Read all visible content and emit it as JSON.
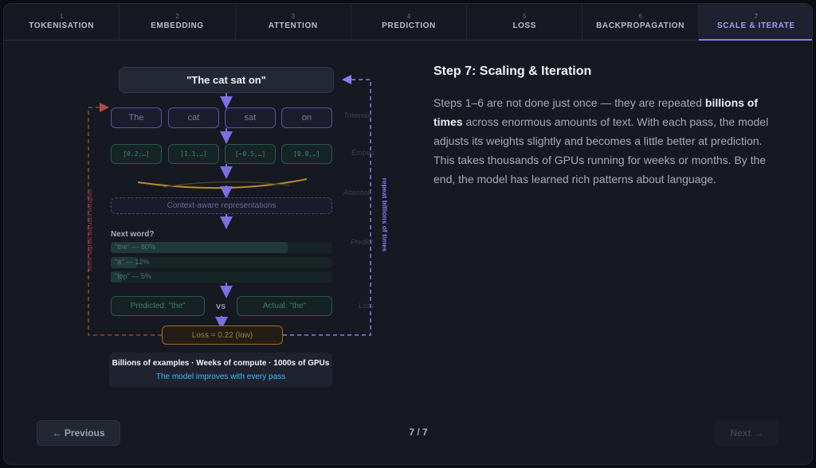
{
  "tabs": [
    {
      "num": "1",
      "label": "TOKENISATION",
      "active": false
    },
    {
      "num": "2",
      "label": "EMBEDDING",
      "active": false
    },
    {
      "num": "3",
      "label": "ATTENTION",
      "active": false
    },
    {
      "num": "4",
      "label": "PREDICTION",
      "active": false
    },
    {
      "num": "5",
      "label": "LOSS",
      "active": false
    },
    {
      "num": "6",
      "label": "BACKPROPAGATION",
      "active": false
    },
    {
      "num": "7",
      "label": "SCALE & ITERATE",
      "active": true
    }
  ],
  "diagram": {
    "input": "\"The cat sat on\"",
    "tokens": [
      "The",
      "cat",
      "sat",
      "on"
    ],
    "embeddings": [
      "[0.2,…]",
      "[1.1,…]",
      "[−0.5,…]",
      "[0.8,…]"
    ],
    "context": "Context-aware representations",
    "next_word_title": "Next word?",
    "predictions": [
      {
        "label": "\"the\" — 80%",
        "prob": 0.8
      },
      {
        "label": "\"a\" — 12%",
        "prob": 0.12
      },
      {
        "label": "\"top\" — 5%",
        "prob": 0.05
      }
    ],
    "predicted": "Predicted: \"the\"",
    "vs": "vs",
    "actual": "Actual: \"the\"",
    "loss": "Loss = 0.22 (low)",
    "side_labels": [
      "Tokenise",
      "Embed",
      "Attention",
      "Predict",
      "Loss"
    ],
    "left_loop_label": "error signal adjusts weights",
    "right_loop_label": "repeat billions of times",
    "summary_line1": "Billions of examples · Weeks of compute · 1000s of GPUs",
    "summary_line2": "The model improves with every pass",
    "colors": {
      "accent": "#8b7cf6",
      "teal": "#2dd4bf",
      "loss": "#f59e0b",
      "error": "#ef4444",
      "highlight": "#38bdf8"
    }
  },
  "panel": {
    "heading": "Step 7: Scaling & Iteration",
    "body_before": "Steps 1–6 are not done just once — they are repeated ",
    "body_bold": "billions of times",
    "body_after": " across enormous amounts of text. With each pass, the model adjusts its weights slightly and becomes a little better at prediction. This takes thousands of GPUs running for weeks or months. By the end, the model has learned rich patterns about language."
  },
  "footer": {
    "prev_label": "← Previous",
    "pager": "7 / 7",
    "next_label": "Next →"
  }
}
